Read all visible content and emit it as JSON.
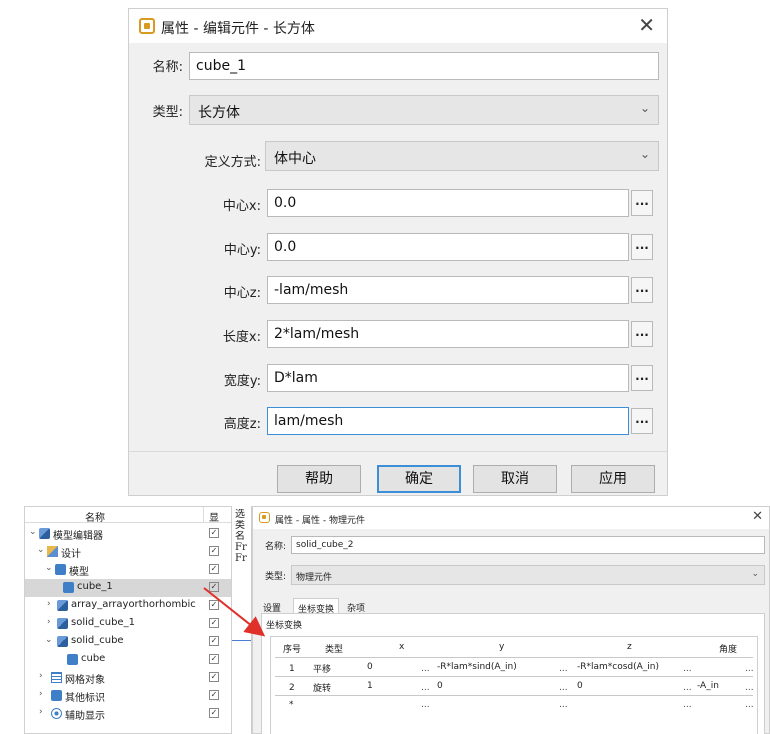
{
  "dialog1": {
    "title": "属性 - 编辑元件 - 长方体",
    "name_label": "名称:",
    "name_value": "cube_1",
    "type_label": "类型:",
    "type_value": "长方体",
    "define_label": "定义方式:",
    "define_value": "体中心",
    "fields": [
      {
        "label": "中心x:",
        "value": "0.0"
      },
      {
        "label": "中心y:",
        "value": "0.0"
      },
      {
        "label": "中心z:",
        "value": "-lam/mesh"
      },
      {
        "label": "长度x:",
        "value": "2*lam/mesh"
      },
      {
        "label": "宽度y:",
        "value": "D*lam"
      },
      {
        "label": "高度z:",
        "value": "lam/mesh"
      }
    ],
    "ellipsis": "...",
    "buttons": {
      "help": "帮助",
      "ok": "确定",
      "cancel": "取消",
      "apply": "应用"
    }
  },
  "tree": {
    "col_name": "名称",
    "col_show": "显",
    "check": "✓",
    "items": [
      {
        "label": "模型编辑器",
        "expander": "⌄",
        "icon": "model-editor-icon"
      },
      {
        "label": "设计",
        "expander": "⌄",
        "icon": "design-icon"
      },
      {
        "label": "模型",
        "expander": "⌄",
        "icon": "model-icon"
      },
      {
        "label": "cube_1",
        "expander": "",
        "icon": "cube-icon"
      },
      {
        "label": "array_arrayorthorhombic",
        "expander": "›",
        "icon": "array-icon"
      },
      {
        "label": "solid_cube_1",
        "expander": "›",
        "icon": "solid-group-icon"
      },
      {
        "label": "solid_cube",
        "expander": "⌄",
        "icon": "solid-group-icon"
      },
      {
        "label": "cube",
        "expander": "",
        "icon": "cube-icon"
      },
      {
        "label": "网格对象",
        "expander": "›",
        "icon": "grid-icon"
      },
      {
        "label": "其他标识",
        "expander": "›",
        "icon": "marker-icon"
      },
      {
        "label": "辅助显示",
        "expander": "›",
        "icon": "eye-icon"
      }
    ]
  },
  "strip": {
    "lines": [
      "选",
      "类",
      "名",
      "Fr",
      "Fr"
    ]
  },
  "dialog2": {
    "title": "属性 - 属性 - 物理元件",
    "name_label": "名称:",
    "name_value": "solid_cube_2",
    "type_label": "类型:",
    "type_value": "物理元件",
    "tabs": [
      "设置",
      "坐标变换",
      "杂项"
    ],
    "group_label": "坐标变换",
    "columns": [
      "序号",
      "类型",
      "x",
      "y",
      "z",
      "角度"
    ],
    "rows": [
      {
        "idx": "1",
        "type": "平移",
        "x": "0",
        "y": "-R*lam*sind(A_in)",
        "z": "-R*lam*cosd(A_in)",
        "angle": ""
      },
      {
        "idx": "2",
        "type": "旋转",
        "x": "1",
        "y": "0",
        "z": "0",
        "angle": "-A_in"
      },
      {
        "idx": "*",
        "type": "",
        "x": "",
        "y": "",
        "z": "",
        "angle": ""
      }
    ],
    "ellipsis": "..."
  },
  "colors": {
    "accent_blue": "#3c8fd6",
    "dialog_bg": "#f0f0f0",
    "arrow_red": "#e0302a",
    "icon_orange": "#d99a22"
  }
}
